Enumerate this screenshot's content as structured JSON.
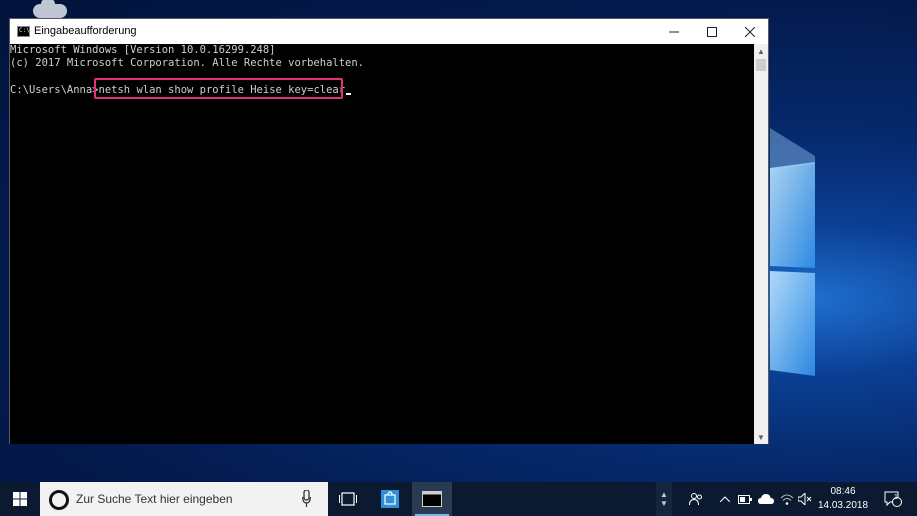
{
  "colors": {
    "highlight": "#e2317a",
    "taskbar": "#0b1a30",
    "console_bg": "#000000",
    "console_fg": "#cfcfcf"
  },
  "window": {
    "title": "Eingabeaufforderung",
    "icon": "cmd-icon"
  },
  "console": {
    "lines": [
      "Microsoft Windows [Version 10.0.16299.248]",
      "(c) 2017 Microsoft Corporation. Alle Rechte vorbehalten."
    ],
    "prompt": "C:\\Users\\Anna>",
    "command": "netsh wlan show profile Heise key=clear"
  },
  "taskbar": {
    "search_placeholder": "Zur Suche Text hier eingeben",
    "time": "08:46",
    "date": "14.03.2018",
    "notification_count": "1"
  }
}
